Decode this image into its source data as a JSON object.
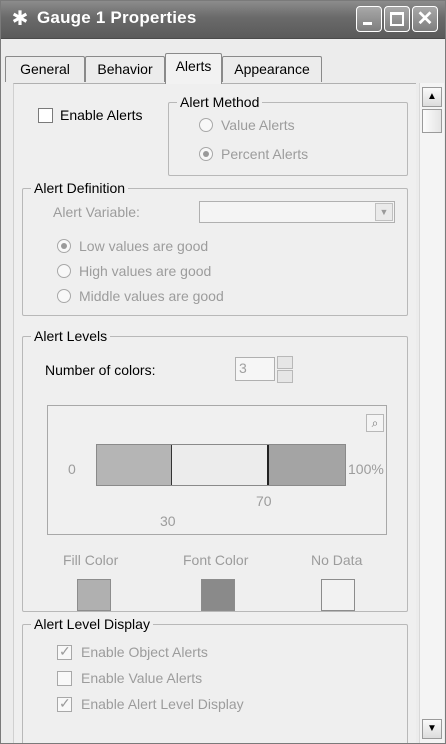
{
  "window": {
    "title": "Gauge 1 Properties"
  },
  "tabs": [
    {
      "label": "General"
    },
    {
      "label": "Behavior"
    },
    {
      "label": "Alerts"
    },
    {
      "label": "Appearance"
    }
  ],
  "active_tab": "Alerts",
  "enable_alerts": {
    "label": "Enable Alerts",
    "checked": false
  },
  "alert_method": {
    "title": "Alert Method",
    "options": [
      {
        "label": "Value Alerts",
        "selected": false
      },
      {
        "label": "Percent Alerts",
        "selected": true
      }
    ]
  },
  "alert_definition": {
    "title": "Alert Definition",
    "variable_label": "Alert Variable:",
    "variable_value": "",
    "options": [
      {
        "label": "Low values are good",
        "selected": true
      },
      {
        "label": "High values are good",
        "selected": false
      },
      {
        "label": "Middle values are good",
        "selected": false
      }
    ]
  },
  "alert_levels": {
    "title": "Alert Levels",
    "num_colors_label": "Number of colors:",
    "num_colors_value": "3",
    "scale_min": "0",
    "scale_max": "100%",
    "threshold_low": "30",
    "threshold_high": "70",
    "segment_colors": [
      "#b5b5b5",
      "#ececec",
      "#a4a4a4"
    ],
    "fill_color_label": "Fill Color",
    "font_color_label": "Font Color",
    "no_data_label": "No Data",
    "fill_color": "#b0b0b0",
    "font_color": "#8a8a8a",
    "no_data_color": "#f2f2f2"
  },
  "alert_level_display": {
    "title": "Alert Level Display",
    "options": [
      {
        "label": "Enable Object Alerts",
        "checked": true
      },
      {
        "label": "Enable Value Alerts",
        "checked": false
      },
      {
        "label": "Enable Alert Level Display",
        "checked": true
      }
    ]
  },
  "icons": {
    "title": "gauge-app-icon",
    "zoom": "magnifier-icon"
  }
}
